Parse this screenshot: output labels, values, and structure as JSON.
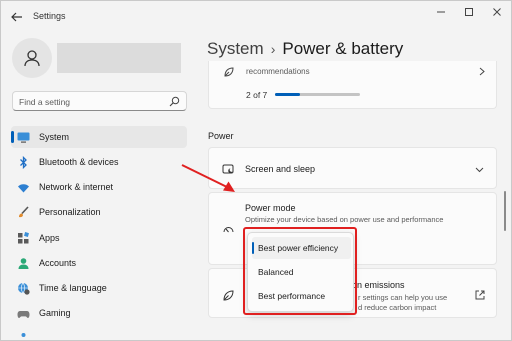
{
  "window": {
    "title": "Settings"
  },
  "search": {
    "placeholder": "Find a setting"
  },
  "sidebar": {
    "items": [
      {
        "label": "System",
        "icon": "monitor-icon",
        "active": true
      },
      {
        "label": "Bluetooth & devices",
        "icon": "bluetooth-icon"
      },
      {
        "label": "Network & internet",
        "icon": "wifi-icon"
      },
      {
        "label": "Personalization",
        "icon": "brush-icon"
      },
      {
        "label": "Apps",
        "icon": "apps-icon"
      },
      {
        "label": "Accounts",
        "icon": "person-icon"
      },
      {
        "label": "Time & language",
        "icon": "globe-clock-icon"
      },
      {
        "label": "Gaming",
        "icon": "gamepad-icon"
      }
    ]
  },
  "breadcrumb": {
    "parent": "System",
    "separator": "›",
    "current": "Power & battery"
  },
  "recommendations": {
    "text": "recommendations",
    "progress_label": "2 of 7",
    "progress_fraction": 0.29
  },
  "power_section": {
    "title": "Power"
  },
  "screen_sleep": {
    "title": "Screen and sleep"
  },
  "power_mode": {
    "title": "Power mode",
    "description": "Optimize your device based on power use and performance",
    "options": [
      "Best power efficiency",
      "Balanced",
      "Best performance"
    ],
    "selected_index": 0
  },
  "emissions": {
    "title_fragment": "on emissions",
    "desc_line1": "r settings can help you use",
    "desc_line2": "d reduce carbon impact"
  },
  "colors": {
    "accent": "#005fb8",
    "annotation": "#e02020"
  }
}
